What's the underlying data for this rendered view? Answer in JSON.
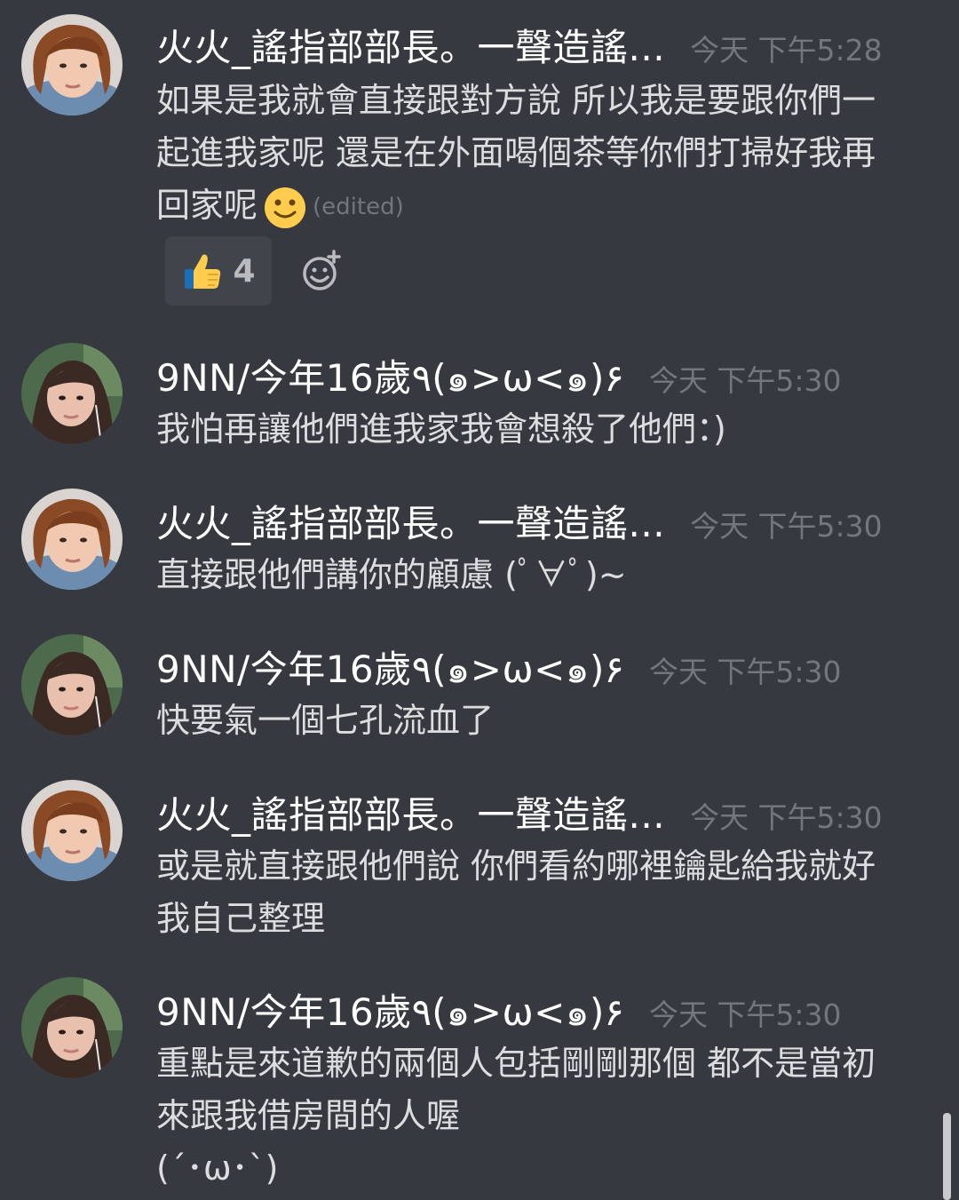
{
  "messages": [
    {
      "author": "火火_謠指部部長。一聲造謠...",
      "time": "今天 下午5:28",
      "avatar": "avatar-orange-hair",
      "lines": [
        "如果是我就會直接跟對方說 所以我是要跟你們一",
        "起進我家呢 還是在外面喝個茶等你們打掃好我再",
        "回家呢"
      ],
      "edited": "(edited)",
      "reaction": {
        "emoji": "thumbs-up",
        "count": "4"
      }
    },
    {
      "author": "9NN/今年16歲٩(๑>ω<๑)۶",
      "time": "今天 下午5:30",
      "avatar": "avatar-dark-hair",
      "lines": [
        "我怕再讓他們進我家我會想殺了他們：)"
      ]
    },
    {
      "author": "火火_謠指部部長。一聲造謠...",
      "time": "今天 下午5:30",
      "avatar": "avatar-orange-hair",
      "lines": [
        "直接跟他們講你的顧慮 (ﾟ∀ﾟ)~"
      ]
    },
    {
      "author": "9NN/今年16歲٩(๑>ω<๑)۶",
      "time": "今天 下午5:30",
      "avatar": "avatar-dark-hair",
      "lines": [
        "快要氣一個七孔流血了"
      ]
    },
    {
      "author": "火火_謠指部部長。一聲造謠...",
      "time": "今天 下午5:30",
      "avatar": "avatar-orange-hair",
      "lines": [
        "或是就直接跟他們說 你們看約哪裡鑰匙給我就好",
        "我自己整理"
      ]
    },
    {
      "author": "9NN/今年16歲٩(๑>ω<๑)۶",
      "time": "今天 下午5:30",
      "avatar": "avatar-dark-hair",
      "lines": [
        "重點是來道歉的兩個人包括剛剛那個 都不是當初",
        "來跟我借房間的人喔",
        "(´･ω･`)"
      ]
    }
  ],
  "colors": {
    "background": "#36393f",
    "name": "#ffffff",
    "text": "#dcddde",
    "muted": "#72767d",
    "reaction_bg": "#40444b"
  }
}
